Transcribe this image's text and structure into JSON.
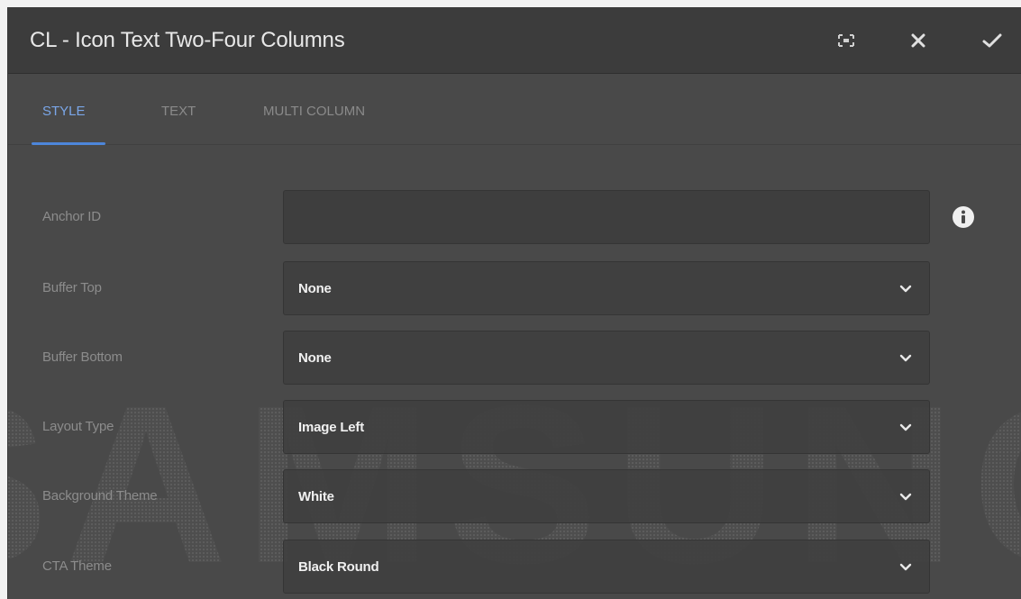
{
  "dialog": {
    "title": "CL - Icon Text Two-Four Columns",
    "icons": {
      "fullscreen": "fullscreen-icon",
      "close": "close-icon",
      "done": "checkmark-icon"
    }
  },
  "tabs": [
    {
      "label": "STYLE",
      "active": true
    },
    {
      "label": "TEXT",
      "active": false
    },
    {
      "label": "MULTI COLUMN",
      "active": false
    }
  ],
  "form": {
    "anchor": {
      "label": "Anchor ID",
      "value": "",
      "info_icon": "info-icon"
    },
    "buffer_top": {
      "label": "Buffer Top",
      "value": "None"
    },
    "buffer_bottom": {
      "label": "Buffer Bottom",
      "value": "None"
    },
    "layout_type": {
      "label": "Layout Type",
      "value": "Image Left"
    },
    "background_theme": {
      "label": "Background Theme",
      "value": "White"
    },
    "cta_theme": {
      "label": "CTA Theme",
      "value": "Black Round"
    }
  },
  "watermark": {
    "text": "SAMSUNG"
  },
  "colors": {
    "accent": "#4d86da",
    "panel": "#494949",
    "header": "#3c3c3c"
  }
}
